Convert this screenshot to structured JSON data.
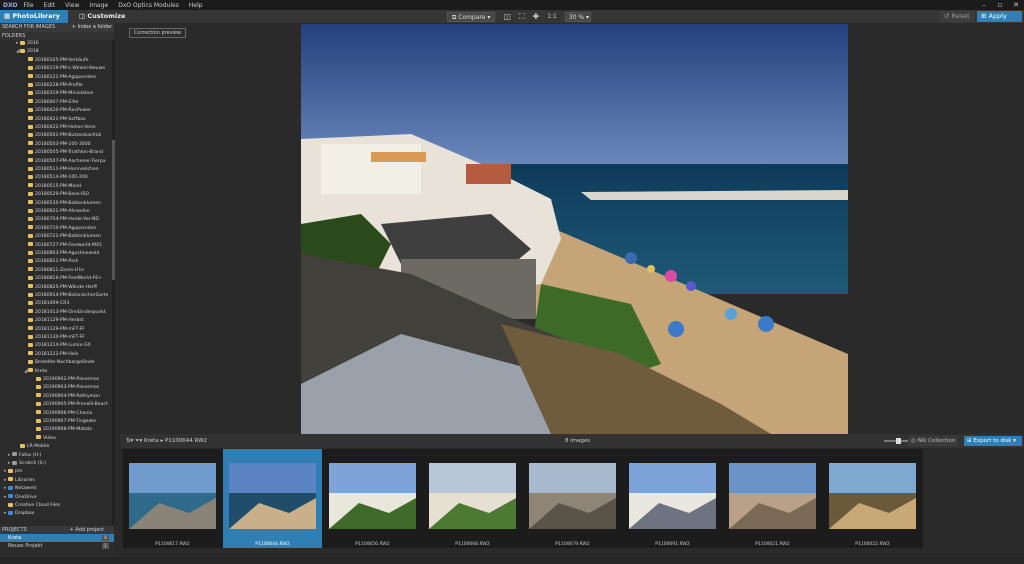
{
  "app": {
    "menu": [
      "File",
      "Edit",
      "View",
      "Image",
      "DxO Optics Modules",
      "Help"
    ],
    "window_controls": [
      "–",
      "▫",
      "✕"
    ]
  },
  "toolbar": {
    "tab_photolibrary": "PhotoLibrary",
    "tab_customize": "Customize",
    "compare": "Compare",
    "ratio": "1:1",
    "zoom": "30 %",
    "reset": "Reset",
    "apply_preset": "Apply preset"
  },
  "sidebar": {
    "search_label": "SEARCH FOR IMAGES",
    "index_label": "+ Index a folder",
    "folders_header": "FOLDERS",
    "tree": [
      {
        "label": "2016",
        "indent": 4,
        "arrow": "▸",
        "icon": "folder"
      },
      {
        "label": "2018",
        "indent": 4,
        "arrow": "◢",
        "icon": "folder"
      },
      {
        "label": "20180105-PM-Verkäufe",
        "indent": 6,
        "arrow": "",
        "icon": "folder"
      },
      {
        "label": "20180119-PM-L-Winkel-Neuwe",
        "indent": 6,
        "arrow": "",
        "icon": "folder"
      },
      {
        "label": "20180121-PM-Agapornden",
        "indent": 6,
        "arrow": "",
        "icon": "folder"
      },
      {
        "label": "20180228-PM-Profile",
        "indent": 6,
        "arrow": "",
        "icon": "folder"
      },
      {
        "label": "20180319-PM-Miniolative",
        "indent": 6,
        "arrow": "",
        "icon": "folder"
      },
      {
        "label": "20180407-PM-Eifel",
        "indent": 6,
        "arrow": "",
        "icon": "folder"
      },
      {
        "label": "20180420-PM-RavPower",
        "indent": 6,
        "arrow": "",
        "icon": "folder"
      },
      {
        "label": "20180421-PM-Softbox",
        "indent": 6,
        "arrow": "",
        "icon": "folder"
      },
      {
        "label": "20180422-PM-Hohes-Venn",
        "indent": 6,
        "arrow": "",
        "icon": "folder"
      },
      {
        "label": "20180501-PM-Butzenbachtal",
        "indent": 6,
        "arrow": "",
        "icon": "folder"
      },
      {
        "label": "20180503-PM-100-3000",
        "indent": 6,
        "arrow": "",
        "icon": "folder"
      },
      {
        "label": "20180505-PM-Triathlon-Brand",
        "indent": 6,
        "arrow": "",
        "icon": "folder"
      },
      {
        "label": "20180507-PM-Aachener-Tierpa",
        "indent": 6,
        "arrow": "",
        "icon": "folder"
      },
      {
        "label": "20180511-PM-Hornveilchen",
        "indent": 6,
        "arrow": "",
        "icon": "folder"
      },
      {
        "label": "20180514-PM-100-200",
        "indent": 6,
        "arrow": "",
        "icon": "folder"
      },
      {
        "label": "20180515-PM-Mond",
        "indent": 6,
        "arrow": "",
        "icon": "folder"
      },
      {
        "label": "20180529-PM-Base-ISO",
        "indent": 6,
        "arrow": "",
        "icon": "folder"
      },
      {
        "label": "20180530-PM-Balkonblumen",
        "indent": 6,
        "arrow": "",
        "icon": "folder"
      },
      {
        "label": "20180621-PM-Ahrweiler",
        "indent": 6,
        "arrow": "",
        "icon": "folder"
      },
      {
        "label": "20180704-PM-Heide-Ver-ND",
        "indent": 6,
        "arrow": "",
        "icon": "folder"
      },
      {
        "label": "20180710-PM-Agapornden",
        "indent": 6,
        "arrow": "",
        "icon": "folder"
      },
      {
        "label": "20180721-PM-Balkonblumen",
        "indent": 6,
        "arrow": "",
        "icon": "folder"
      },
      {
        "label": "20180727-PM-Feelworld-M45",
        "indent": 6,
        "arrow": "",
        "icon": "folder"
      },
      {
        "label": "20180803-PM-Agustinewald",
        "indent": 6,
        "arrow": "",
        "icon": "folder"
      },
      {
        "label": "20180811-PM-Park",
        "indent": 6,
        "arrow": "",
        "icon": "folder"
      },
      {
        "label": "20180811-Zoom-H1n",
        "indent": 6,
        "arrow": "",
        "icon": "folder"
      },
      {
        "label": "20180816-PM-FeelWorld-F6+",
        "indent": 6,
        "arrow": "",
        "icon": "folder"
      },
      {
        "label": "20180825-PM-Wände-Herff",
        "indent": 6,
        "arrow": "",
        "icon": "folder"
      },
      {
        "label": "20180914-PM-BotanischerGarte",
        "indent": 6,
        "arrow": "",
        "icon": "folder"
      },
      {
        "label": "20181009-CR3",
        "indent": 6,
        "arrow": "",
        "icon": "folder"
      },
      {
        "label": "20181013-PM-Dreiländerpunkt",
        "indent": 6,
        "arrow": "",
        "icon": "folder"
      },
      {
        "label": "20181129-PM-Herbst",
        "indent": 6,
        "arrow": "",
        "icon": "folder"
      },
      {
        "label": "20181129-PM-mFT-FF",
        "indent": 6,
        "arrow": "",
        "icon": "folder"
      },
      {
        "label": "20181130-PM-mFT-FF",
        "indent": 6,
        "arrow": "",
        "icon": "folder"
      },
      {
        "label": "20181214-PM-Lumix-GX",
        "indent": 6,
        "arrow": "",
        "icon": "folder"
      },
      {
        "label": "20181222-PM-Heis",
        "indent": 6,
        "arrow": "",
        "icon": "folder"
      },
      {
        "label": "Bestellte-Nachbargelände",
        "indent": 6,
        "arrow": "",
        "icon": "folder"
      },
      {
        "label": "Kreta",
        "indent": 6,
        "arrow": "◢",
        "icon": "folder"
      },
      {
        "label": "20190902-PM-Panormos",
        "indent": 8,
        "arrow": "",
        "icon": "folder"
      },
      {
        "label": "20190903-PM-Panormos",
        "indent": 8,
        "arrow": "",
        "icon": "folder"
      },
      {
        "label": "20190904-PM-Rethymon",
        "indent": 8,
        "arrow": "",
        "icon": "folder"
      },
      {
        "label": "20190905-PM-Prevelli-Beach",
        "indent": 8,
        "arrow": "",
        "icon": "folder"
      },
      {
        "label": "20190906-PM-Chania",
        "indent": 8,
        "arrow": "",
        "icon": "folder"
      },
      {
        "label": "20190907-PM-Tingeate",
        "indent": 8,
        "arrow": "",
        "icon": "folder"
      },
      {
        "label": "20190908-PM-Matala",
        "indent": 8,
        "arrow": "",
        "icon": "folder"
      },
      {
        "label": "Video",
        "indent": 8,
        "arrow": "",
        "icon": "folder"
      },
      {
        "label": "LR-Mobile",
        "indent": 4,
        "arrow": "",
        "icon": "folder"
      },
      {
        "label": "Fotos (H:)",
        "indent": 2,
        "arrow": "▸",
        "icon": "drive"
      },
      {
        "label": "Scratch (S:)",
        "indent": 2,
        "arrow": "▸",
        "icon": "drive"
      },
      {
        "label": "pm",
        "indent": 1,
        "arrow": "▸",
        "icon": "folder"
      },
      {
        "label": "Libraries",
        "indent": 1,
        "arrow": "▸",
        "icon": "folder"
      },
      {
        "label": "Netzwerk",
        "indent": 1,
        "arrow": "▸",
        "icon": "blue"
      },
      {
        "label": "OneDrive",
        "indent": 1,
        "arrow": "▸",
        "icon": "blue"
      },
      {
        "label": "Creative Cloud Files",
        "indent": 1,
        "arrow": "",
        "icon": "folder"
      },
      {
        "label": "Dropbox",
        "indent": 1,
        "arrow": "▸",
        "icon": "blue"
      }
    ],
    "projects_header": "PROJECTS",
    "add_project": "+ Add project",
    "projects": [
      {
        "name": "Kreta",
        "count": "8",
        "selected": true
      },
      {
        "name": "Neues Projekt",
        "count": "1",
        "selected": false
      }
    ]
  },
  "viewer": {
    "correction_preview": "Correction preview"
  },
  "filmstrip_bar": {
    "breadcrumb": "Kreta ▸ P1100644.RW2",
    "count": "8 images",
    "nik": "Nik Collection",
    "export": "Export to disk"
  },
  "filmstrip": [
    {
      "name": "P1100617.RW2",
      "selected": false
    },
    {
      "name": "P1100644.RW2",
      "selected": true
    },
    {
      "name": "P1100656.RW2",
      "selected": false
    },
    {
      "name": "P1100668.RW2",
      "selected": false
    },
    {
      "name": "P1100679.RW2",
      "selected": false
    },
    {
      "name": "P1100691.RW2",
      "selected": false
    },
    {
      "name": "P1100021.RW2",
      "selected": false
    },
    {
      "name": "P1100022.RW2",
      "selected": false
    }
  ],
  "colors": {
    "accent": "#2f7fb4",
    "folder": "#e6c15d"
  }
}
